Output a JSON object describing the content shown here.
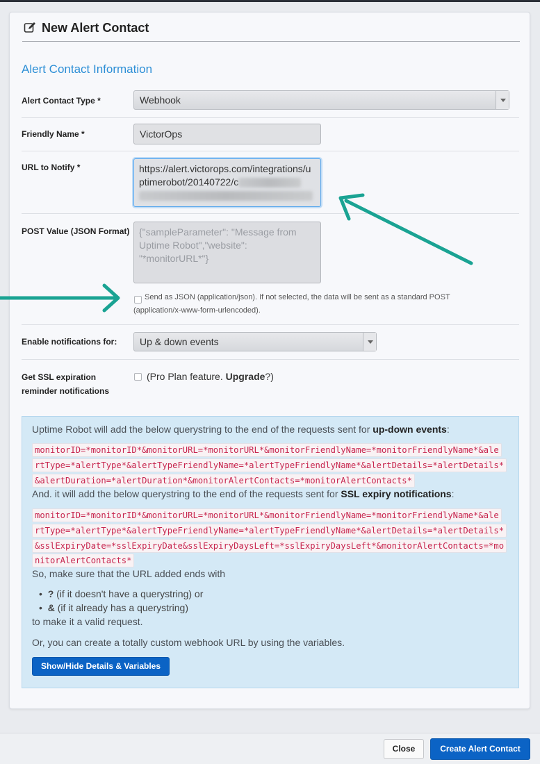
{
  "header": {
    "title": "New Alert Contact",
    "icon": "edit-icon"
  },
  "section_title": "Alert Contact Information",
  "fields": {
    "type": {
      "label": "Alert Contact Type *",
      "value": "Webhook"
    },
    "friendly_name": {
      "label": "Friendly Name *",
      "value": "VictorOps"
    },
    "url": {
      "label": "URL to Notify *",
      "value_line1": "https://alert.victorops.com/integrations/u",
      "value_line2": "ptimerobot/20140722/c"
    },
    "post": {
      "label": "POST Value (JSON Format)",
      "placeholder_line1": "{\"sampleParameter\": \"Message from",
      "placeholder_line2": "Uptime Robot\",\"website\":",
      "placeholder_line3": "\"*monitorURL*\"}"
    },
    "send_json": {
      "line1": "Send as JSON (application/json). If not selected, the data will be sent as a standard POST",
      "line2": "(application/x-www-form-urlencoded)."
    },
    "notifications": {
      "label": "Enable notifications for:",
      "value": "Up & down events"
    },
    "ssl": {
      "label_line1": "Get SSL expiration",
      "label_line2": "reminder notifications",
      "text_pre": "(Pro Plan feature. ",
      "text_link": "Upgrade",
      "text_post": "?)"
    }
  },
  "info": {
    "intro_pre": "Uptime Robot will add the below querystring to the end of the requests sent for ",
    "intro_bold": "up-down events",
    "intro_post": ":",
    "code1": [
      "monitorID=*monitorID*&monitorURL=*monitorURL*&monitorFriendlyName=*monitorFriendlyName*&ale",
      "rtType=*alertType*&alertTypeFriendlyName=*alertTypeFriendlyName*&alertDetails=*alertDetails*",
      "&alertDuration=*alertDuration*&monitorAlertContacts=*monitorAlertContacts*"
    ],
    "ssl_pre": "And. it will add the below querystring to the end of the requests sent for ",
    "ssl_bold": "SSL expiry notifications",
    "ssl_post": ":",
    "code2": [
      "monitorID=*monitorID*&monitorURL=*monitorURL*&monitorFriendlyName=*monitorFriendlyName*&ale",
      "rtType=*alertType*&alertTypeFriendlyName=*alertTypeFriendlyName*&alertDetails=*alertDetails*",
      "&sslExpiryDate=*sslExpiryDate&sslExpiryDaysLeft=*sslExpiryDaysLeft*&monitorAlertContacts=*mo",
      "nitorAlertContacts*"
    ],
    "make_sure": "So, make sure that the URL added ends with",
    "bullet1_bold": "?",
    "bullet1_text": " (if it doesn't have a querystring) or",
    "bullet2_bold": "&",
    "bullet2_text": " (if it already has a querystring)",
    "valid": "to make it a valid request.",
    "custom": "Or, you can create a totally custom webhook URL by using the variables.",
    "details_button": "Show/Hide Details & Variables"
  },
  "footer": {
    "close": "Close",
    "create": "Create Alert Contact"
  },
  "colors": {
    "accent": "#0b63c5",
    "arrow": "#1aa393",
    "title_blue": "#2d8fd6",
    "code": "#c7254e"
  }
}
